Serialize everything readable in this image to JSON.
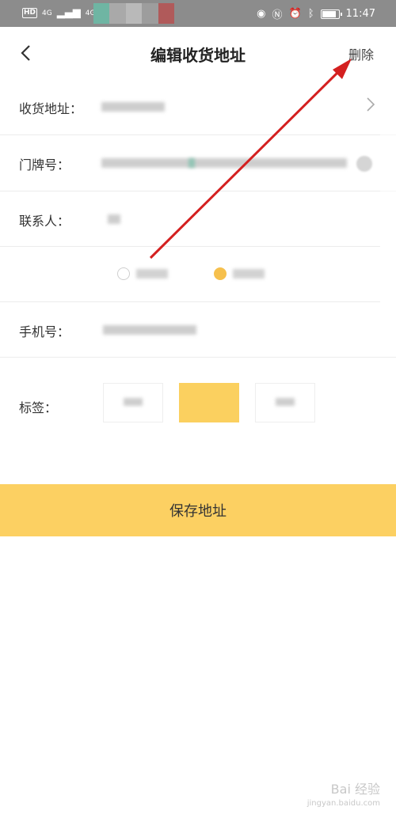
{
  "status_bar": {
    "network_left": "HD",
    "signal1": "4G",
    "signal2": "4G",
    "time": "11:47"
  },
  "nav": {
    "title": "编辑收货地址",
    "delete_label": "删除"
  },
  "form": {
    "address_label": "收货地址：",
    "house_number_label": "门牌号：",
    "contact_label": "联系人：",
    "phone_label": "手机号：",
    "tags_label": "标签："
  },
  "save_button": "保存地址",
  "watermark": {
    "brand": "Bai 经验",
    "url": "jingyan.baidu.com"
  },
  "colors": {
    "accent": "#fcd062",
    "arrow": "#d42020",
    "status_bar": "#8c8c8c"
  }
}
